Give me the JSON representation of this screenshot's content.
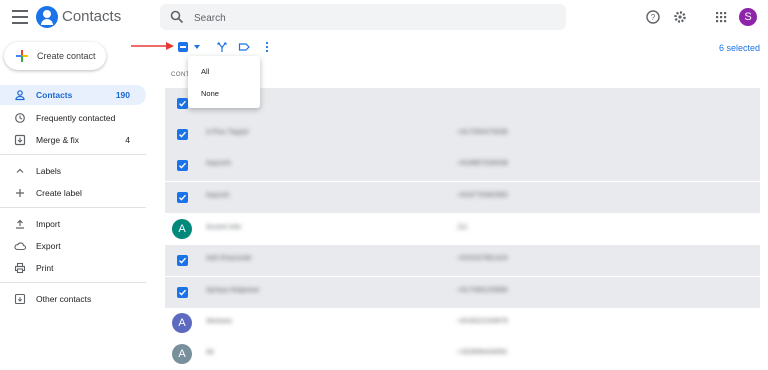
{
  "header": {
    "app_title": "Contacts",
    "search_placeholder": "Search",
    "user_initial": "S",
    "icons": [
      "menu-icon",
      "contacts-logo",
      "search-icon",
      "help-icon",
      "settings-icon",
      "apps-icon"
    ]
  },
  "sidebar": {
    "create_label": "Create contact",
    "items": [
      {
        "label": "Contacts",
        "count": "190",
        "icon": "person-icon",
        "active": true
      },
      {
        "label": "Frequently contacted",
        "count": "",
        "icon": "history-icon"
      },
      {
        "label": "Merge & fix",
        "count": "4",
        "icon": "merge-icon"
      },
      {
        "label": "Labels",
        "count": "",
        "icon": "chevron-up-icon"
      },
      {
        "label": "Create label",
        "count": "",
        "icon": "plus-icon"
      },
      {
        "label": "Import",
        "count": "",
        "icon": "upload-icon"
      },
      {
        "label": "Export",
        "count": "",
        "icon": "cloud-icon"
      },
      {
        "label": "Print",
        "count": "",
        "icon": "print-icon"
      },
      {
        "label": "Other contacts",
        "count": "",
        "icon": "archive-icon"
      }
    ]
  },
  "toolbar": {
    "selected_text": "6 selected",
    "column_header": "CONT"
  },
  "select_menu": {
    "items": [
      "All",
      "None"
    ]
  },
  "contacts": [
    {
      "name": "",
      "phone": "",
      "selected": true,
      "avatar": ""
    },
    {
      "name": "A Plus Topper",
      "phone": "+917000479336",
      "selected": true,
      "avatar": ""
    },
    {
      "name": "Aayushi",
      "phone": "+919867028338",
      "selected": true,
      "avatar": ""
    },
    {
      "name": "Aayush",
      "phone": "+918776362583",
      "selected": true,
      "avatar": ""
    },
    {
      "name": "Accent Info",
      "phone": "111",
      "selected": false,
      "avatar": "A",
      "avatar_color": "#00897b"
    },
    {
      "name": "Adit Khanzode",
      "phone": "+919167861424",
      "selected": true,
      "avatar": ""
    },
    {
      "name": "Ajinkya Malpekar",
      "phone": "+917066233986",
      "selected": true,
      "avatar": ""
    },
    {
      "name": "Akshara",
      "phone": "+919322243979",
      "selected": false,
      "avatar": "A",
      "avatar_color": "#5c6bc0"
    },
    {
      "name": "Ali",
      "phone": "+332806434091",
      "selected": false,
      "avatar": "A",
      "avatar_color": "#78909c"
    }
  ],
  "colors": {
    "accent": "#1a73e8",
    "arrow": "#e53935",
    "selected_row": "#e8eaed"
  }
}
